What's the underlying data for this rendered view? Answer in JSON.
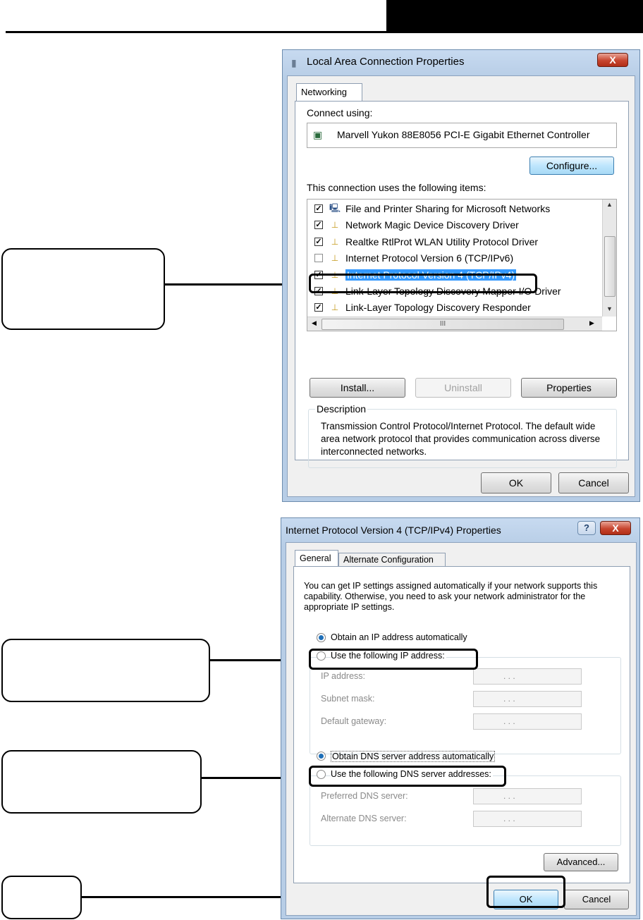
{
  "lan_dialog": {
    "title": "Local Area Connection Properties",
    "close_glyph": "X",
    "tab": "Networking",
    "connect_using_label": "Connect using:",
    "adapter": "Marvell Yukon 88E8056 PCI-E Gigabit Ethernet Controller",
    "configure_button": "Configure...",
    "items_label": "This connection uses the following items:",
    "items": [
      {
        "label": "File and Printer Sharing for Microsoft Networks",
        "checked": true
      },
      {
        "label": "Network Magic Device Discovery Driver",
        "checked": true
      },
      {
        "label": "Realtke RtlProt WLAN Utility Protocol Driver",
        "checked": true
      },
      {
        "label": "Internet Protocol Version 6 (TCP/IPv6)",
        "checked": false
      },
      {
        "label": "Internet Protocol Version 4 (TCP/IPv4)",
        "checked": true,
        "selected": true
      },
      {
        "label": "Link-Layer Topology Discovery Mapper I/O Driver",
        "checked": true
      },
      {
        "label": "Link-Layer Topology Discovery Responder",
        "checked": true
      }
    ],
    "install_button": "Install...",
    "uninstall_button": "Uninstall",
    "properties_button": "Properties",
    "description_label": "Description",
    "description_text": "Transmission Control Protocol/Internet Protocol. The default wide area network protocol that provides communication across diverse interconnected networks.",
    "ok_button": "OK",
    "cancel_button": "Cancel",
    "scroll_h_glyph": "III"
  },
  "ipv4_dialog": {
    "title": "Internet Protocol Version 4 (TCP/IPv4) Properties",
    "help_glyph": "?",
    "close_glyph": "X",
    "tab_general": "General",
    "tab_alternate": "Alternate Configuration",
    "intro": "You can get IP settings assigned automatically if your network supports this capability. Otherwise, you need to ask your network administrator for the appropriate IP settings.",
    "obtain_ip_auto": "Obtain an IP address automatically",
    "use_following_ip": "Use the following IP address:",
    "ip_address_label": "IP address:",
    "subnet_mask_label": "Subnet mask:",
    "default_gateway_label": "Default gateway:",
    "obtain_dns_auto": "Obtain DNS server address automatically",
    "use_following_dns": "Use the following DNS server addresses:",
    "preferred_dns_label": "Preferred DNS server:",
    "alternate_dns_label": "Alternate DNS server:",
    "ip_placeholder_dots": ".   .   .",
    "advanced_button": "Advanced...",
    "ok_button": "OK",
    "cancel_button": "Cancel"
  }
}
